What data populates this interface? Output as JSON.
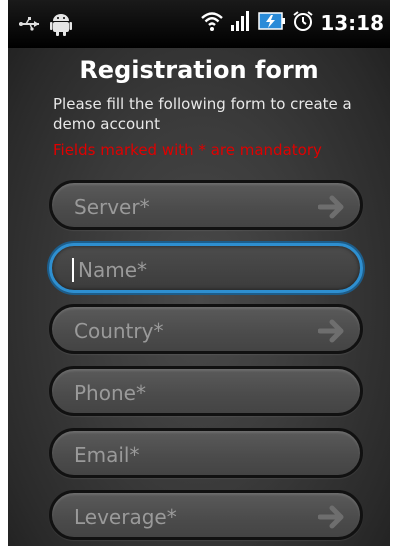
{
  "status_bar": {
    "time": "13:18",
    "icons": [
      "usb-debug-icon",
      "android-icon",
      "wifi-icon",
      "signal-icon",
      "battery-charging-icon",
      "alarm-icon"
    ]
  },
  "form": {
    "title": "Registration form",
    "subtitle": "Please fill the following form to create a demo account",
    "mandatory_note": "Fields marked with * are mandatory",
    "mandatory_color": "#e00000",
    "focus_color": "#2e8fd0",
    "fields": [
      {
        "placeholder": "Server*",
        "has_arrow": true
      },
      {
        "placeholder": "Name*",
        "has_arrow": false,
        "focused": true
      },
      {
        "placeholder": "Country*",
        "has_arrow": true
      },
      {
        "placeholder": "Phone*",
        "has_arrow": false
      },
      {
        "placeholder": "Email*",
        "has_arrow": false
      },
      {
        "placeholder": "Leverage*",
        "has_arrow": true
      }
    ]
  }
}
